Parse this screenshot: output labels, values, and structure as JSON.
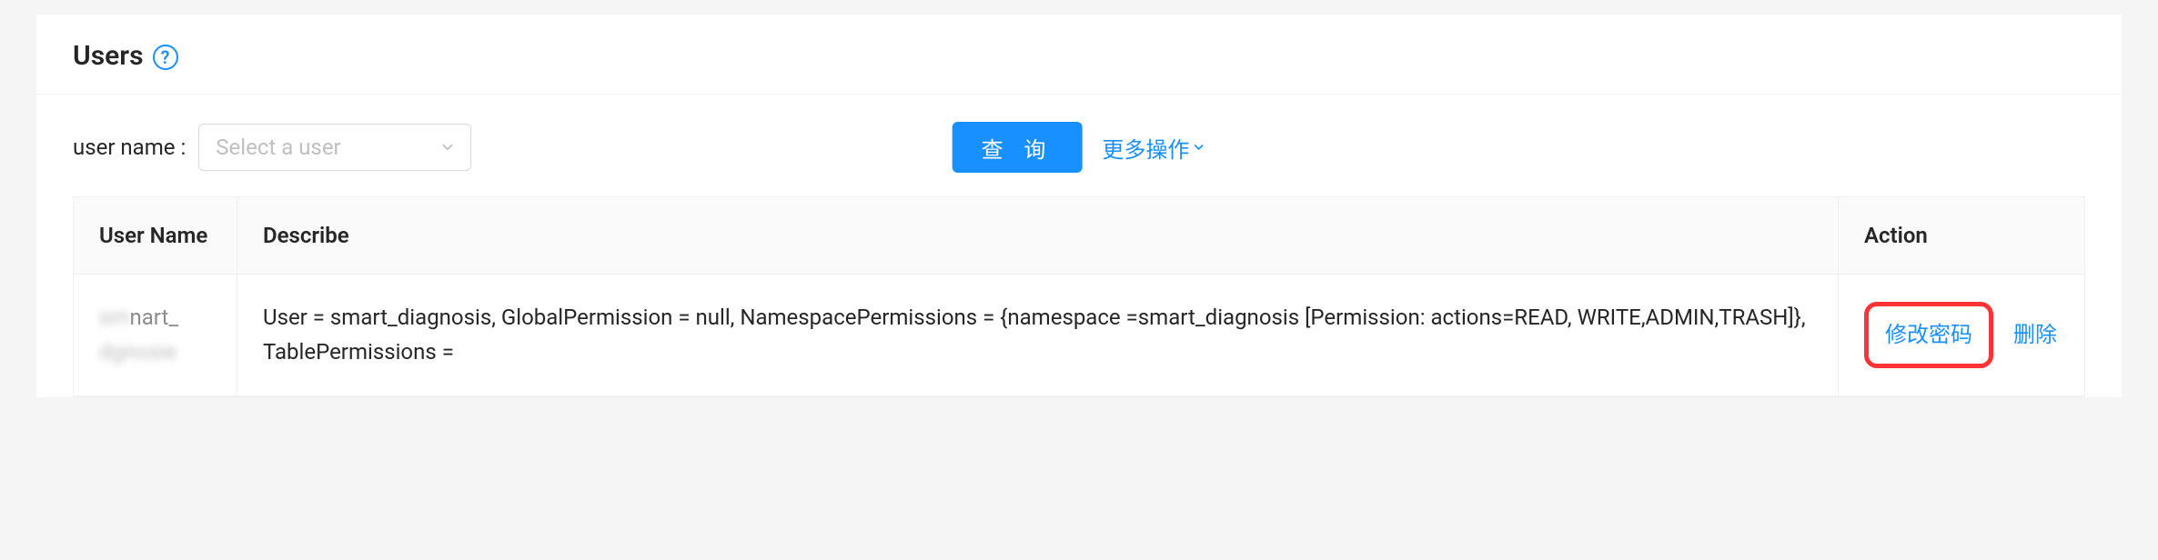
{
  "header": {
    "title": "Users"
  },
  "toolbar": {
    "user_name_label": "user name :",
    "select_placeholder": "Select a user",
    "query_label": "查 询",
    "more_actions_label": "更多操作"
  },
  "table": {
    "columns": {
      "username": "User Name",
      "describe": "Describe",
      "action": "Action"
    },
    "rows": [
      {
        "username_visible_fragment": "nart_",
        "username_blurred_prefix": "sm",
        "username_blurred_line2": "dgnosie",
        "describe": "User = smart_diagnosis, GlobalPermission = null, NamespacePermissions = {namespace =smart_diagnosis [Permission: actions=READ, WRITE,ADMIN,TRASH]}, TablePermissions =",
        "action_change_pw": "修改密码",
        "action_delete": "删除"
      }
    ]
  }
}
